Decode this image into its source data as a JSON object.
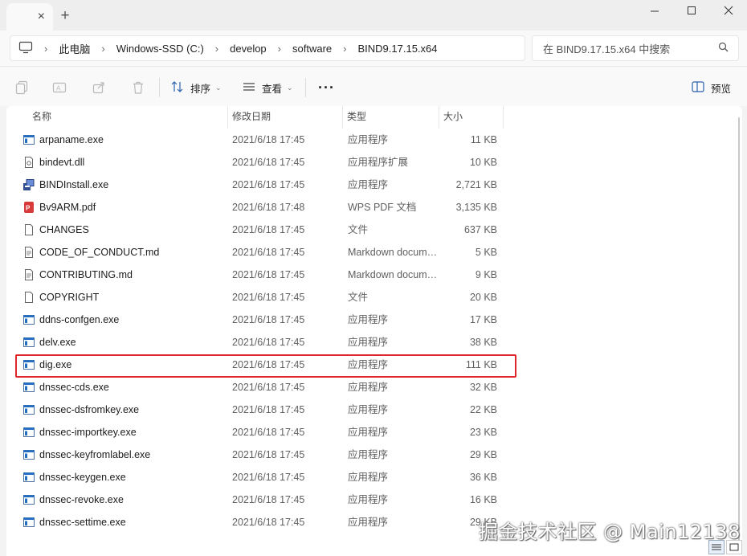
{
  "window": {
    "tab_close": "×",
    "new_tab": "+"
  },
  "breadcrumb": [
    "此电脑",
    "Windows-SSD (C:)",
    "develop",
    "software",
    "BIND9.17.15.x64"
  ],
  "search": {
    "placeholder": "在 BIND9.17.15.x64 中搜索"
  },
  "toolbar": {
    "sort_label": "排序",
    "view_label": "查看",
    "more_label": "···",
    "preview_label": "预览"
  },
  "columns": {
    "name": "名称",
    "date": "修改日期",
    "type": "类型",
    "size": "大小"
  },
  "files": [
    {
      "name": "arpaname.exe",
      "date": "2021/6/18 17:45",
      "type": "应用程序",
      "size": "11 KB",
      "icon": "exe-icon"
    },
    {
      "name": "bindevt.dll",
      "date": "2021/6/18 17:45",
      "type": "应用程序扩展",
      "size": "10 KB",
      "icon": "dll-icon"
    },
    {
      "name": "BINDInstall.exe",
      "date": "2021/6/18 17:45",
      "type": "应用程序",
      "size": "2,721 KB",
      "icon": "installer-icon"
    },
    {
      "name": "Bv9ARM.pdf",
      "date": "2021/6/18 17:48",
      "type": "WPS PDF 文档",
      "size": "3,135 KB",
      "icon": "pdf-icon"
    },
    {
      "name": "CHANGES",
      "date": "2021/6/18 17:45",
      "type": "文件",
      "size": "637 KB",
      "icon": "file-icon"
    },
    {
      "name": "CODE_OF_CONDUCT.md",
      "date": "2021/6/18 17:45",
      "type": "Markdown document",
      "size": "5 KB",
      "icon": "md-icon"
    },
    {
      "name": "CONTRIBUTING.md",
      "date": "2021/6/18 17:45",
      "type": "Markdown document",
      "size": "9 KB",
      "icon": "md-icon"
    },
    {
      "name": "COPYRIGHT",
      "date": "2021/6/18 17:45",
      "type": "文件",
      "size": "20 KB",
      "icon": "file-icon"
    },
    {
      "name": "ddns-confgen.exe",
      "date": "2021/6/18 17:45",
      "type": "应用程序",
      "size": "17 KB",
      "icon": "exe-icon"
    },
    {
      "name": "delv.exe",
      "date": "2021/6/18 17:45",
      "type": "应用程序",
      "size": "38 KB",
      "icon": "exe-icon"
    },
    {
      "name": "dig.exe",
      "date": "2021/6/18 17:45",
      "type": "应用程序",
      "size": "111 KB",
      "icon": "exe-icon",
      "highlighted": true
    },
    {
      "name": "dnssec-cds.exe",
      "date": "2021/6/18 17:45",
      "type": "应用程序",
      "size": "32 KB",
      "icon": "exe-icon"
    },
    {
      "name": "dnssec-dsfromkey.exe",
      "date": "2021/6/18 17:45",
      "type": "应用程序",
      "size": "22 KB",
      "icon": "exe-icon"
    },
    {
      "name": "dnssec-importkey.exe",
      "date": "2021/6/18 17:45",
      "type": "应用程序",
      "size": "23 KB",
      "icon": "exe-icon"
    },
    {
      "name": "dnssec-keyfromlabel.exe",
      "date": "2021/6/18 17:45",
      "type": "应用程序",
      "size": "29 KB",
      "icon": "exe-icon"
    },
    {
      "name": "dnssec-keygen.exe",
      "date": "2021/6/18 17:45",
      "type": "应用程序",
      "size": "36 KB",
      "icon": "exe-icon"
    },
    {
      "name": "dnssec-revoke.exe",
      "date": "2021/6/18 17:45",
      "type": "应用程序",
      "size": "16 KB",
      "icon": "exe-icon"
    },
    {
      "name": "dnssec-settime.exe",
      "date": "2021/6/18 17:45",
      "type": "应用程序",
      "size": "29 KB",
      "icon": "exe-icon"
    }
  ],
  "colors": {
    "highlight": "#e0262b",
    "exe_blue": "#1f6fc4",
    "pdf_red": "#d83b3b"
  },
  "watermark": "掘金技术社区 @ Main12138"
}
